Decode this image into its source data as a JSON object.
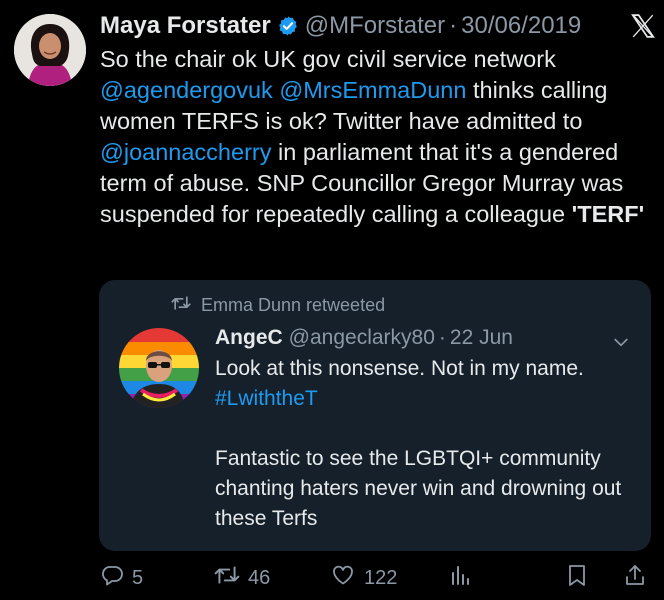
{
  "tweet": {
    "author_name": "Maya Forstater",
    "handle": "@MForstater",
    "dot": "·",
    "date": "30/06/2019",
    "text": {
      "p1": "So the chair ok UK gov civil service network ",
      "m1": "@agendergovuk",
      "s1": " ",
      "m2": "@MrsEmmaDunn",
      "p2": " thinks calling women TERFS is ok? Twitter have admitted to ",
      "m3": "@joannaccherry",
      "p3": " in parliament that it's a gendered term of abuse. SNP Councillor Gregor Murray was suspended for repeatedly calling a colleague ",
      "p4": "'TERF'"
    }
  },
  "quote": {
    "retweeted_by": "Emma Dunn retweeted",
    "author_name": "AngeC",
    "handle": "@angeclarky80",
    "dot": "·",
    "date": "22 Jun",
    "line1": "Look at this nonsense. Not in my name.",
    "hashtag": "#LwiththeT",
    "line2": "Fantastic to see the LGBTQI+ community chanting haters never win and drowning out these Terfs"
  },
  "actions": {
    "replies": "5",
    "retweets": "46",
    "likes": "122"
  },
  "colors": {
    "background": "#000000",
    "text": "#e7e9ea",
    "secondary": "#8b98a5",
    "link": "#1d9bf0",
    "quote_bg": "#15202b",
    "verified": "#1d9bf0"
  },
  "icons": [
    "verified-badge-icon",
    "x-logo-icon",
    "retweet-icon",
    "chevron-down-icon",
    "reply-icon",
    "like-icon",
    "views-icon",
    "bookmark-icon",
    "share-icon"
  ]
}
